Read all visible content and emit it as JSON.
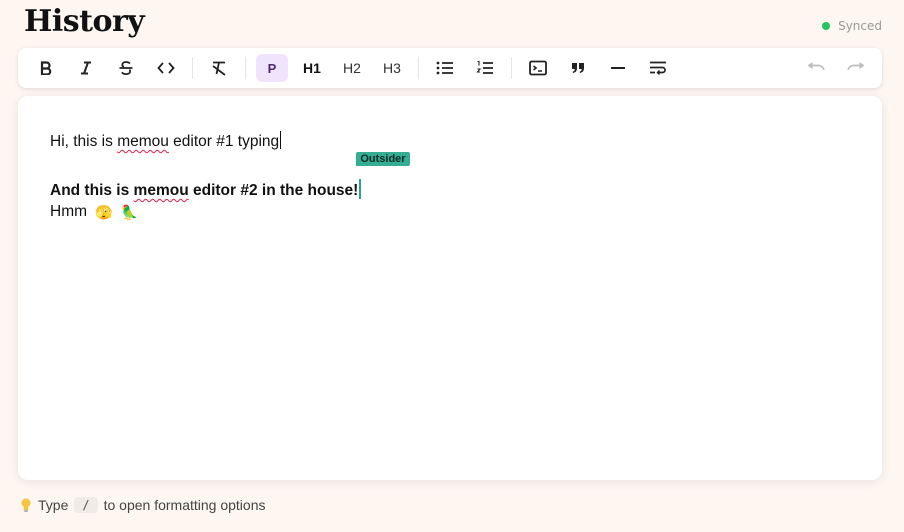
{
  "page": {
    "title": "History"
  },
  "status": {
    "label": "Synced",
    "color": "#22c55e"
  },
  "toolbar": {
    "paragraph_label": "P",
    "h1_label": "H1",
    "h2_label": "H2",
    "h3_label": "H3",
    "icons": [
      "bold-icon",
      "italic-icon",
      "strikethrough-icon",
      "code-icon",
      "clear-format-icon",
      "bullet-list-icon",
      "ordered-list-icon",
      "code-block-icon",
      "quote-icon",
      "horizontal-rule-icon",
      "hard-break-icon",
      "undo-icon",
      "redo-icon"
    ]
  },
  "editor": {
    "line1": {
      "pre": "Hi, this is ",
      "misspelled": "memou",
      "post": " editor #1 typing"
    },
    "line2": {
      "pre": "And this is ",
      "misspelled": "memou",
      "post": " editor #2 in the house!"
    },
    "line3": {
      "text": "Hmm",
      "emoji1": "🫣",
      "emoji2": "🦜"
    },
    "collaborator": {
      "name": "Outsider",
      "color": "#35ad93"
    }
  },
  "footer": {
    "icon": "lightbulb-icon",
    "pre": "Type",
    "key": "/",
    "post": "to open formatting options"
  }
}
